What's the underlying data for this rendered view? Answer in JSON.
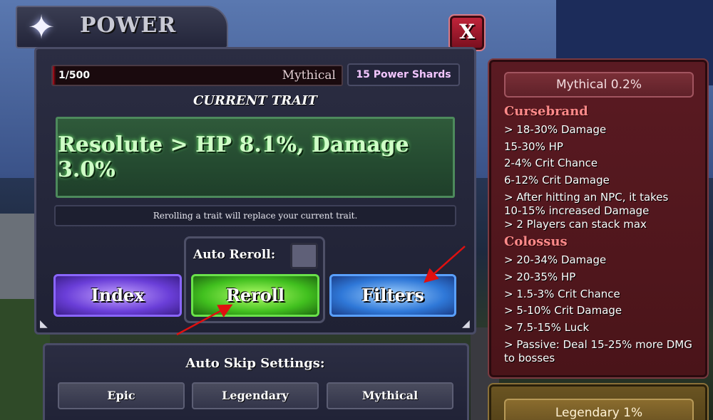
{
  "title": "POWER",
  "close_label": "X",
  "progress": {
    "count": "1/500",
    "rarity": "Mythical",
    "fraction": 0.002
  },
  "shards": "15 Power Shards",
  "current_trait_heading": "CURRENT TRAIT",
  "current_trait": "Resolute > HP 8.1%, Damage 3.0%",
  "info_text": "Rerolling a trait will replace your current trait.",
  "auto_reroll_label": "Auto Reroll:",
  "buttons": {
    "index": "Index",
    "reroll": "Reroll",
    "filters": "Filters"
  },
  "auto_skip": {
    "heading": "Auto Skip Settings:",
    "options": [
      "Epic",
      "Legendary",
      "Mythical"
    ]
  },
  "mythical_panel": {
    "header": "Mythical 0.2%",
    "traits": [
      {
        "name": "Cursebrand",
        "lines": [
          "> 18-30% Damage",
          "15-30% HP",
          "2-4% Crit Chance",
          "6-12% Crit Damage",
          "> After hitting an NPC, it takes",
          "10-15% increased Damage",
          "> 2 Players can stack max"
        ]
      },
      {
        "name": "Colossus",
        "lines": [
          "> 20-34% Damage",
          "> 20-35% HP",
          "> 1.5-3% Crit Chance",
          "> 5-10% Crit Damage",
          "> 7.5-15% Luck",
          "> Passive: Deal 15-25% more DMG",
          "to bosses"
        ]
      }
    ]
  },
  "legendary_panel": {
    "header": "Legendary 1%"
  },
  "colors": {
    "mythical": "#5a1a22",
    "legendary": "#6a5422",
    "trait_green": "#cfffc7",
    "arrow": "#e01010"
  }
}
